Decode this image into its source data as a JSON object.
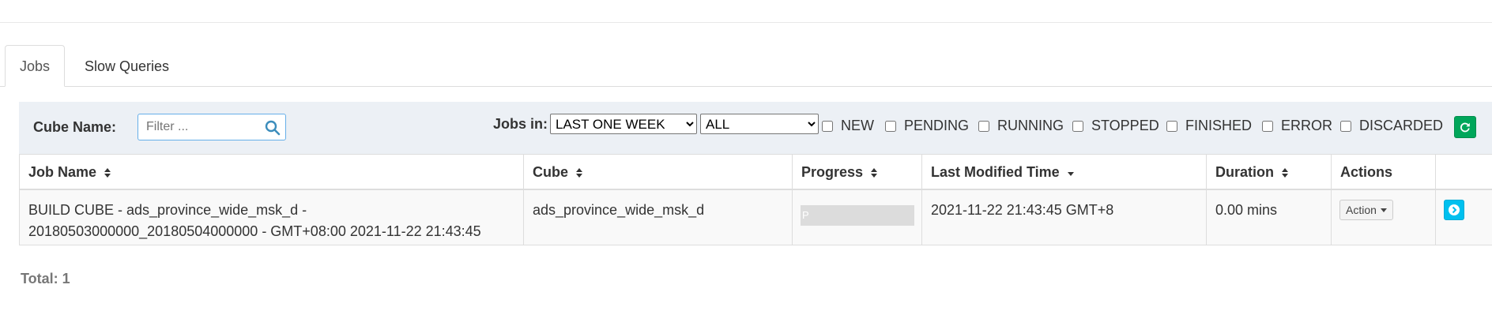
{
  "tabs": [
    {
      "label": "Jobs",
      "active": true
    },
    {
      "label": "Slow Queries",
      "active": false
    }
  ],
  "filter": {
    "cube_name_label": "Cube Name:",
    "search_placeholder": "Filter ...",
    "search_value": "",
    "jobs_in_label": "Jobs in:",
    "time_range": "LAST ONE WEEK",
    "project": "ALL",
    "statuses": [
      {
        "label": "NEW",
        "checked": false
      },
      {
        "label": "PENDING",
        "checked": false
      },
      {
        "label": "RUNNING",
        "checked": false
      },
      {
        "label": "STOPPED",
        "checked": false
      },
      {
        "label": "FINISHED",
        "checked": false
      },
      {
        "label": "ERROR",
        "checked": false
      },
      {
        "label": "DISCARDED",
        "checked": false
      }
    ],
    "refresh_icon": "refresh-icon",
    "refresh_color": "#00a65a"
  },
  "table": {
    "headers": [
      "Job Name",
      "Cube",
      "Progress",
      "Last Modified Time",
      "Duration",
      "Actions"
    ],
    "rows": [
      {
        "job_name_line1": "BUILD CUBE - ads_province_wide_msk_d -",
        "job_name_line2": "20180503000000_20180504000000 - GMT+08:00 2021-11-22 21:43:45",
        "cube": "ads_province_wide_msk_d",
        "progress_text": "P",
        "progress": 0,
        "last_modified": "2021-11-22 21:43:45 GMT+8",
        "duration": "0.00 mins",
        "action_label": "Action",
        "detail_icon": "chevron-circle-right-icon",
        "detail_color": "#00c0ef"
      }
    ]
  },
  "total_label": "Total: 1"
}
